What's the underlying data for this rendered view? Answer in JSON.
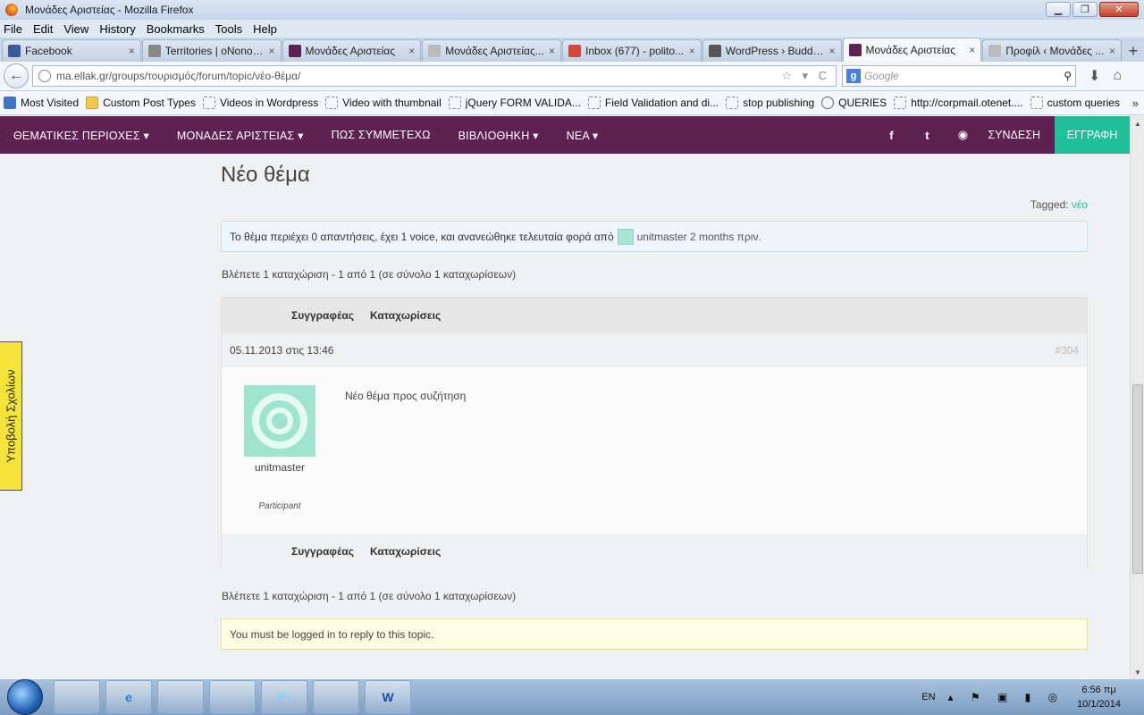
{
  "window": {
    "title": "Μονάδες Αριστείας - Mozilla Firefox",
    "minimize": "▁",
    "restore": "❐",
    "close": "✕"
  },
  "menu": [
    "File",
    "Edit",
    "View",
    "History",
    "Bookmarks",
    "Tools",
    "Help"
  ],
  "tabs": [
    {
      "label": "Facebook",
      "icon_color": "#3b5998"
    },
    {
      "label": "Territories | oNonos...",
      "icon_color": "#888888"
    },
    {
      "label": "Μονάδες Αριστείας",
      "icon_color": "#5e2152"
    },
    {
      "label": "Μονάδες Αριστείας...",
      "icon_color": "#bbbbbb"
    },
    {
      "label": "Inbox (677) - polito...",
      "icon_color": "#d44638"
    },
    {
      "label": "WordPress › Buddy...",
      "icon_color": "#555555"
    },
    {
      "label": "Μονάδες Αριστείας",
      "icon_color": "#5e2152"
    },
    {
      "label": "Προφίλ ‹ Μονάδες ...",
      "icon_color": "#bbbbbb"
    }
  ],
  "tab_close": "×",
  "new_tab": "+",
  "nav": {
    "back": "←",
    "url": "ma.ellak.gr/groups/τουρισμός/forum/topic/νέο-θέμα/",
    "url_icons": "☆ ▾ C",
    "search_engine": "g",
    "search_placeholder": "Google",
    "search_icon": "⚲",
    "download_icon": "⬇",
    "home_icon": "⌂"
  },
  "bookmarks": [
    {
      "label": "Most Visited",
      "kind": "first"
    },
    {
      "label": "Custom Post Types",
      "kind": "folder"
    },
    {
      "label": "Videos in Wordpress",
      "kind": "page"
    },
    {
      "label": "Video with thumbnail",
      "kind": "page"
    },
    {
      "label": "jQuery FORM VALIDA...",
      "kind": "page"
    },
    {
      "label": "Field Validation and di...",
      "kind": "page"
    },
    {
      "label": "stop publishing",
      "kind": "page"
    },
    {
      "label": "QUERIES",
      "kind": "wp"
    },
    {
      "label": "http://corpmail.otenet....",
      "kind": "page"
    },
    {
      "label": "custom queries",
      "kind": "page"
    }
  ],
  "bookmarks_more": "»",
  "site_nav": {
    "menu": [
      "ΘΕΜΑΤΙΚΕΣ ΠΕΡΙΟΧΕΣ ▾",
      "ΜΟΝΑΔΕΣ ΑΡΙΣΤΕΙΑΣ ▾",
      "ΠΩΣ ΣΥΜΜΕΤΕΧΩ",
      "ΒΙΒΛΙΟΘΗΚΗ ▾",
      "ΝΕΑ ▾"
    ],
    "social": [
      "f",
      "t",
      "◉"
    ],
    "login": "ΣΥΝΔΕΣΗ",
    "register": "ΕΓΓΡΑΦΗ"
  },
  "topic": {
    "title": "Νέο θέμα",
    "tagged_label": "Tagged:",
    "tag": "νέο",
    "info_prefix": "Το θέμα περιέχει 0 απαντήσεις, έχει 1 voice, και ανανεώθηκε τελευταία φορά από",
    "info_user": "unitmaster 2 months πριν.",
    "count_line": "Βλέπετε 1 καταχώριση - 1 από 1 (σε σύνολο 1 καταχωρίσεων)",
    "col_author": "Συγγραφέας",
    "col_posts": "Καταχωρίσεις",
    "post": {
      "date": "05.11.2013 στις 13:46",
      "id": "#304",
      "author": "unitmaster",
      "role": "Participant",
      "content": "Νέο θέμα προς συζήτηση"
    },
    "login_notice": "You must be logged in to reply to this topic."
  },
  "feedback_tab": "Υποβολή Σχολίων",
  "scroll": {
    "up": "▲",
    "down": "▼"
  },
  "taskbar": {
    "apps": [
      "",
      "e",
      "",
      "",
      "Ps",
      "",
      "W"
    ],
    "lang": "EN",
    "tray_icons": "▴ ⚑ ▣ ▮ ◎",
    "time": "6:56 πμ",
    "date": "10/1/2014"
  }
}
